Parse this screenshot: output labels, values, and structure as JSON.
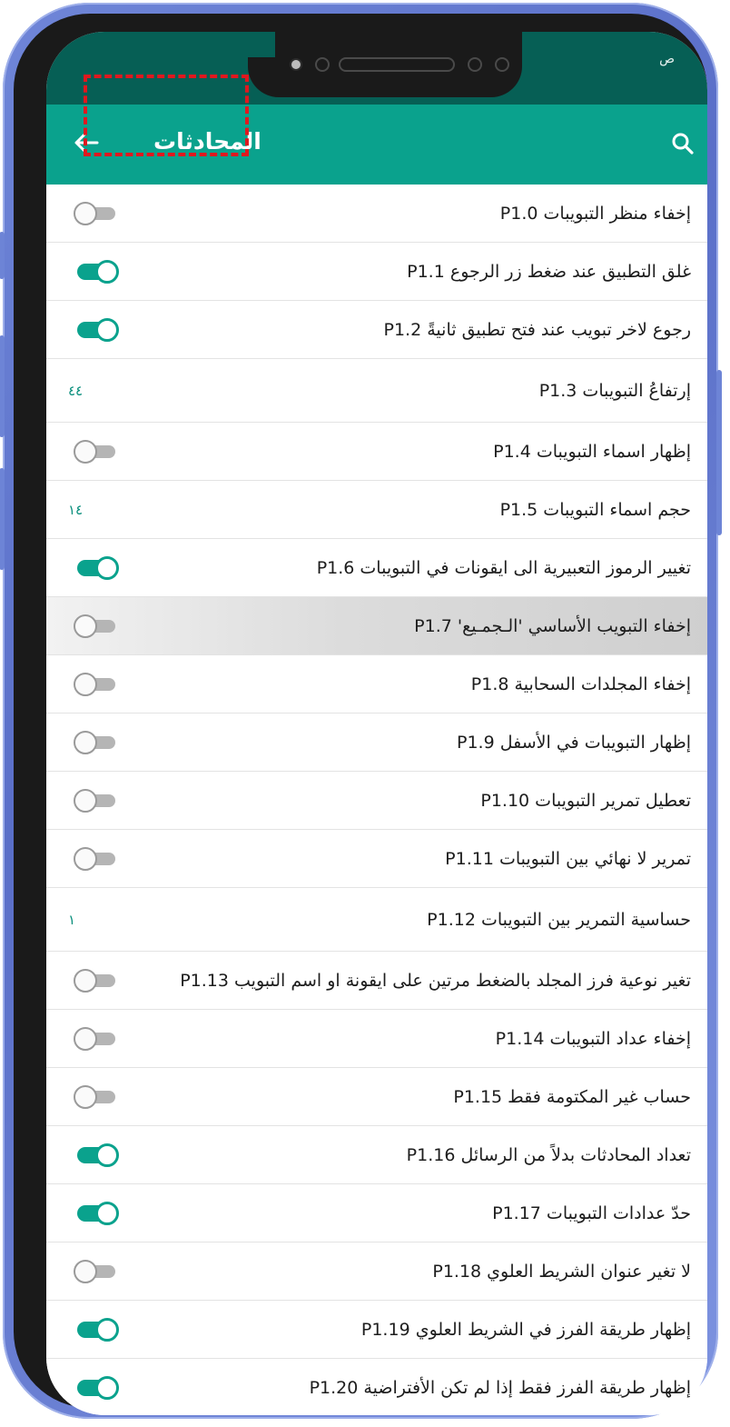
{
  "status_bar": {
    "text": "ص"
  },
  "appbar": {
    "title": "المحادثات",
    "back_icon": "back-arrow-icon",
    "search_icon": "search-icon",
    "color": "#0aa28d",
    "status_color": "#065f55",
    "highlight_color": "#e0181f"
  },
  "settings": [
    {
      "label": "إخفاء منظر التبويبات P1.0",
      "type": "switch",
      "on": false
    },
    {
      "label": "غلق التطبيق عند ضغط زر الرجوع P1.1",
      "type": "switch",
      "on": true
    },
    {
      "label": "رجوع لاخر تبويب عند فتح تطبيق ثانيةً P1.2",
      "type": "switch",
      "on": true
    },
    {
      "label": "إرتفاعُ التبويبات P1.3",
      "type": "value",
      "value": "٤٤"
    },
    {
      "label": "إظهار اسماء التبويبات P1.4",
      "type": "switch",
      "on": false
    },
    {
      "label": "حجم اسماء التبويبات P1.5",
      "type": "value",
      "value": "١٤"
    },
    {
      "label": "تغيير الرموز التعبيرية الى ايقونات في التبويبات P1.6",
      "type": "switch",
      "on": true
    },
    {
      "label": "إخفاء التبويب الأساسي 'الـجمـيع' P1.7",
      "type": "switch",
      "on": false,
      "pressed": true
    },
    {
      "label": "إخفاء المجلدات السحابية P1.8",
      "type": "switch",
      "on": false
    },
    {
      "label": "إظهار التبويبات في الأسفل P1.9",
      "type": "switch",
      "on": false
    },
    {
      "label": "تعطيل تمرير التبويبات P1.10",
      "type": "switch",
      "on": false
    },
    {
      "label": "تمرير لا نهائي بين التبويبات P1.11",
      "type": "switch",
      "on": false
    },
    {
      "label": "حساسية التمرير بين التبويبات P1.12",
      "type": "value",
      "value": "١"
    },
    {
      "label": "تغير نوعية فرز المجلد بالضغط مرتين على ايقونة او اسم التبويب P1.13",
      "type": "switch",
      "on": false
    },
    {
      "label": "إخفاء عداد التبويبات P1.14",
      "type": "switch",
      "on": false
    },
    {
      "label": "حساب غير المكتومة فقط P1.15",
      "type": "switch",
      "on": false
    },
    {
      "label": "تعداد المحادثات بدلاً من الرسائل P1.16",
      "type": "switch",
      "on": true
    },
    {
      "label": "حدّ عدادات التبويبات P1.17",
      "type": "switch",
      "on": true
    },
    {
      "label": "لا تغير عنوان الشريط العلوي P1.18",
      "type": "switch",
      "on": false
    },
    {
      "label": "إظهار طريقة الفرز في الشريط العلوي P1.19",
      "type": "switch",
      "on": true
    },
    {
      "label": "إظهار طريقة الفرز فقط إذا لم تكن الأفتراضية P1.20",
      "type": "switch",
      "on": true
    }
  ]
}
